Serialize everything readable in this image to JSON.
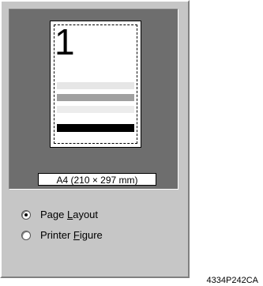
{
  "preview": {
    "page_number": "1",
    "paper_size_label": "A4 (210 × 297 mm)"
  },
  "options": {
    "page_layout": {
      "before": "Page ",
      "accel": "L",
      "after": "ayout",
      "selected": true
    },
    "printer_figure": {
      "before": "Printer ",
      "accel": "F",
      "after": "igure",
      "selected": false
    }
  },
  "figure_code": "4334P242CA"
}
